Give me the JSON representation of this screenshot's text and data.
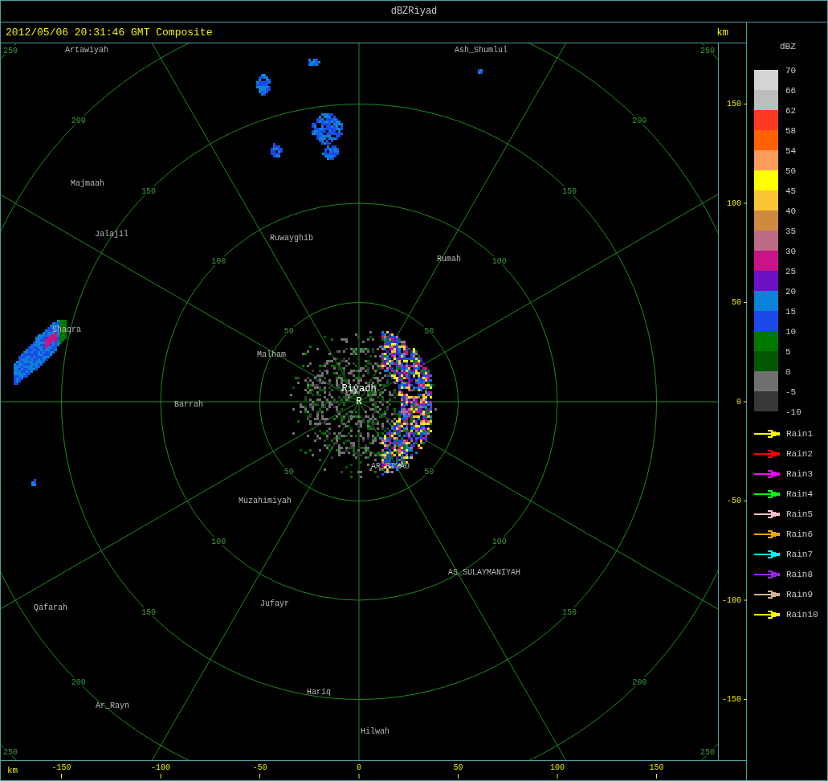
{
  "window": {
    "title": "dBZRiyad"
  },
  "header": {
    "timestamp": "2012/05/06 20:31:46 GMT Composite",
    "unit": "km"
  },
  "map": {
    "range_rings": [
      {
        "labels": [
          "50",
          "50",
          "50",
          "50"
        ]
      },
      {
        "labels": [
          "100",
          "100",
          "100",
          "100"
        ]
      },
      {
        "labels": [
          "150",
          "150",
          "150",
          "150"
        ]
      },
      {
        "labels": [
          "200",
          "200",
          "200",
          "200"
        ]
      },
      {
        "labels": [
          "250",
          "250",
          "250",
          "250"
        ]
      }
    ],
    "places": [
      {
        "name": "Artawiyah",
        "kind": "town"
      },
      {
        "name": "Ash_Shumlul",
        "kind": "town"
      },
      {
        "name": "Majmaah",
        "kind": "town"
      },
      {
        "name": "Jalajil",
        "kind": "town"
      },
      {
        "name": "Ruwayghib",
        "kind": "town"
      },
      {
        "name": "Rumah",
        "kind": "town"
      },
      {
        "name": "Shaqra",
        "kind": "town"
      },
      {
        "name": "Malham",
        "kind": "town"
      },
      {
        "name": "Riyadh",
        "kind": "radar"
      },
      {
        "name": "Barrah",
        "kind": "town"
      },
      {
        "name": "R",
        "kind": "radar"
      },
      {
        "name": "AR_RIYAD",
        "kind": "town"
      },
      {
        "name": "Muzahimiyah",
        "kind": "town"
      },
      {
        "name": "AS_SULAYMANIYAH",
        "kind": "town"
      },
      {
        "name": "Jufayr",
        "kind": "town"
      },
      {
        "name": "Qafarah",
        "kind": "town"
      },
      {
        "name": "Hariq",
        "kind": "town"
      },
      {
        "name": "Ar_Rayn",
        "kind": "town"
      },
      {
        "name": "Hilwah",
        "kind": "town"
      }
    ]
  },
  "right_axis": {
    "ticks": [
      "150",
      "100",
      "50",
      "0",
      "-50",
      "-100",
      "-150"
    ]
  },
  "bottom_axis": {
    "unit": "km",
    "ticks": [
      "-150",
      "-100",
      "-50",
      "0",
      "50",
      "100",
      "150"
    ]
  },
  "legend": {
    "title": "dBZ",
    "bands": [
      {
        "color": "#d4d4d4"
      },
      {
        "color": "#bdbdbd"
      },
      {
        "color": "#ff3a20"
      },
      {
        "color": "#ff6000"
      },
      {
        "color": "#ff9c5c"
      },
      {
        "color": "#ffff00"
      },
      {
        "color": "#fbc634"
      },
      {
        "color": "#d08a40"
      },
      {
        "color": "#bd6a88"
      },
      {
        "color": "#c81488"
      },
      {
        "color": "#6a12c4"
      },
      {
        "color": "#0a82d8"
      },
      {
        "color": "#1c4ae8"
      },
      {
        "color": "#007800"
      },
      {
        "color": "#005800"
      },
      {
        "color": "#707070"
      },
      {
        "color": "#383838"
      }
    ],
    "ticks": [
      "70",
      "66",
      "62",
      "58",
      "54",
      "50",
      "45",
      "40",
      "35",
      "30",
      "25",
      "20",
      "15",
      "10",
      "5",
      "0",
      "-5",
      "-10"
    ]
  },
  "tracks": [
    {
      "label": "Rain1",
      "color": "#ffff00"
    },
    {
      "label": "Rain2",
      "color": "#ff0000"
    },
    {
      "label": "Rain3",
      "color": "#ff00ff"
    },
    {
      "label": "Rain4",
      "color": "#00ff00"
    },
    {
      "label": "Rain5",
      "color": "#ffc0cb"
    },
    {
      "label": "Rain6",
      "color": "#ffa500"
    },
    {
      "label": "Rain7",
      "color": "#00ffff"
    },
    {
      "label": "Rain8",
      "color": "#a020f0"
    },
    {
      "label": "Rain9",
      "color": "#d2b48c"
    },
    {
      "label": "Rain10",
      "color": "#ffff00"
    }
  ]
}
